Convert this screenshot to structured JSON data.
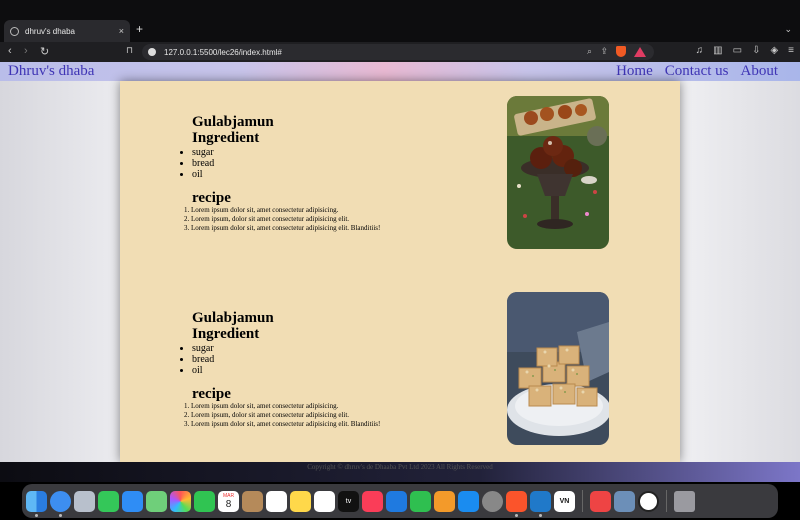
{
  "browser": {
    "tab_title": "dhruv's dhaba",
    "tab_close": "×",
    "new_tab": "+",
    "url": "127.0.0.1:5500/lec26/index.html#"
  },
  "nav": {
    "brand": "Dhruv's dhaba",
    "links": [
      "Home",
      "Contact us",
      "About"
    ]
  },
  "cards": [
    {
      "dish": "Gulabjamun",
      "ingredient_heading": "Ingredient",
      "ingredients": [
        "sugar",
        "bread",
        "oil"
      ],
      "recipe_heading": "recipe",
      "steps": [
        "Lorem ipsum dolor sit, amet consectetur adipisicing.",
        "Lorem ipsum, dolor sit amet consectetur adipisicing elit.",
        "Lorem ipsum dolor sit, amet consectetur adipisicing elit. Blanditiis!"
      ],
      "image": "gulab-jamun-photo"
    },
    {
      "dish": "Gulabjamun",
      "ingredient_heading": "Ingredient",
      "ingredients": [
        "sugar",
        "bread",
        "oil"
      ],
      "recipe_heading": "recipe",
      "steps": [
        "Lorem ipsum dolor sit, amet consectetur adipisicing.",
        "Lorem ipsum, dolor sit amet consectetur adipisicing elit.",
        "Lorem ipsum dolor sit, amet consectetur adipisicing elit. Blanditiis!"
      ],
      "image": "barfi-photo"
    }
  ],
  "footer": {
    "copyright": "Copyright © dhruv's de Dhaaba Pvt Ltd 2023 All Rights Reserved"
  },
  "dock": {
    "apps": [
      "Finder",
      "Safari",
      "Launchpad",
      "Messages",
      "Mail",
      "Maps",
      "Photos",
      "FaceTime",
      "Calendar",
      "Contacts",
      "Reminders",
      "Notes",
      "Freeform",
      "TV",
      "Music",
      "Keynote",
      "Numbers",
      "Pages",
      "App Store",
      "System Settings",
      "Brave",
      "VS Code",
      "VN",
      "Preview",
      "Screenshot",
      "Clock",
      "Trash"
    ],
    "calendar_month": "MAR",
    "calendar_day": "8",
    "tv_label": "tv",
    "vn_label": "VN"
  },
  "colors": {
    "content_bg": "#f1ddb4",
    "nav_link": "#3f35b5"
  }
}
